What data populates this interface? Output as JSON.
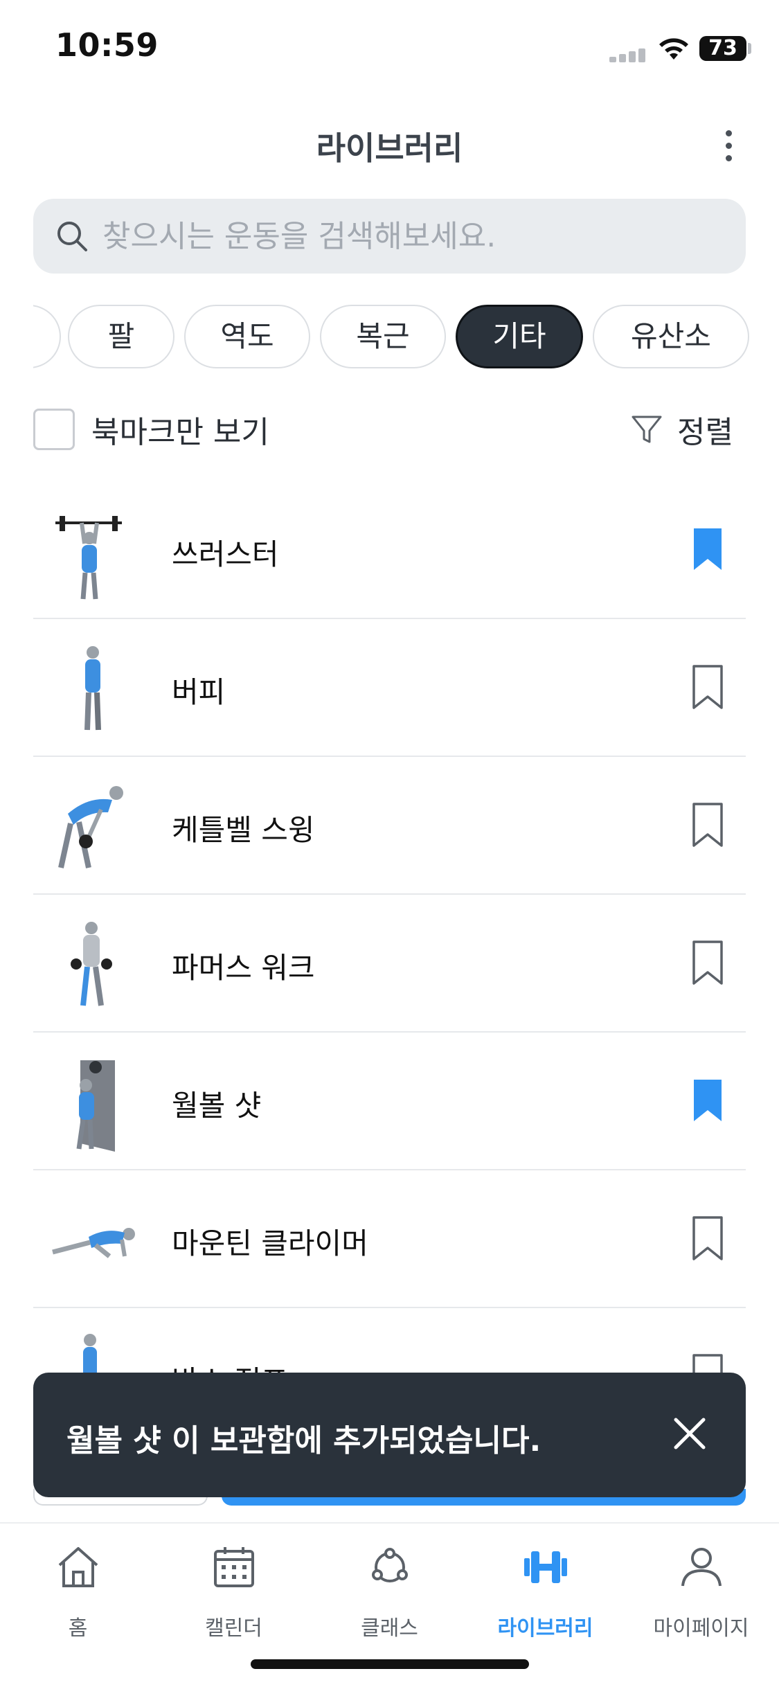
{
  "status_bar": {
    "time": "10:59",
    "battery": "73"
  },
  "header": {
    "title": "라이브러리",
    "more_icon": "more-vertical-icon"
  },
  "search": {
    "placeholder": "찾으시는 운동을 검색해보세요.",
    "value": ""
  },
  "chips": {
    "items": [
      {
        "label": ""
      },
      {
        "label": "팔"
      },
      {
        "label": "역도"
      },
      {
        "label": "복근"
      },
      {
        "label": "기타",
        "selected": true
      },
      {
        "label": "유산소"
      }
    ]
  },
  "filter": {
    "bookmark_only_label": "북마크만 보기",
    "bookmark_only_checked": false,
    "sort_label": "정렬"
  },
  "exercises": [
    {
      "name": "쓰러스터",
      "bookmarked": true
    },
    {
      "name": "버피",
      "bookmarked": false
    },
    {
      "name": "케틀벨 스윙",
      "bookmarked": false
    },
    {
      "name": "파머스 워크",
      "bookmarked": false
    },
    {
      "name": "월볼 샷",
      "bookmarked": true
    },
    {
      "name": "마운틴 클라이머",
      "bookmarked": false
    },
    {
      "name": "박스 점프",
      "bookmarked": false
    }
  ],
  "toast": {
    "message": "월볼 샷 이 보관함에 추가되었습니다."
  },
  "tabbar": {
    "items": [
      {
        "label": "홈",
        "icon": "home-icon"
      },
      {
        "label": "캘린더",
        "icon": "calendar-icon"
      },
      {
        "label": "클래스",
        "icon": "class-icon"
      },
      {
        "label": "라이브러리",
        "icon": "dumbbell-icon",
        "active": true
      },
      {
        "label": "마이페이지",
        "icon": "person-icon"
      }
    ]
  },
  "colors": {
    "accent": "#2f93f3",
    "dark": "#2a323b",
    "divider": "#e6e8eb"
  }
}
